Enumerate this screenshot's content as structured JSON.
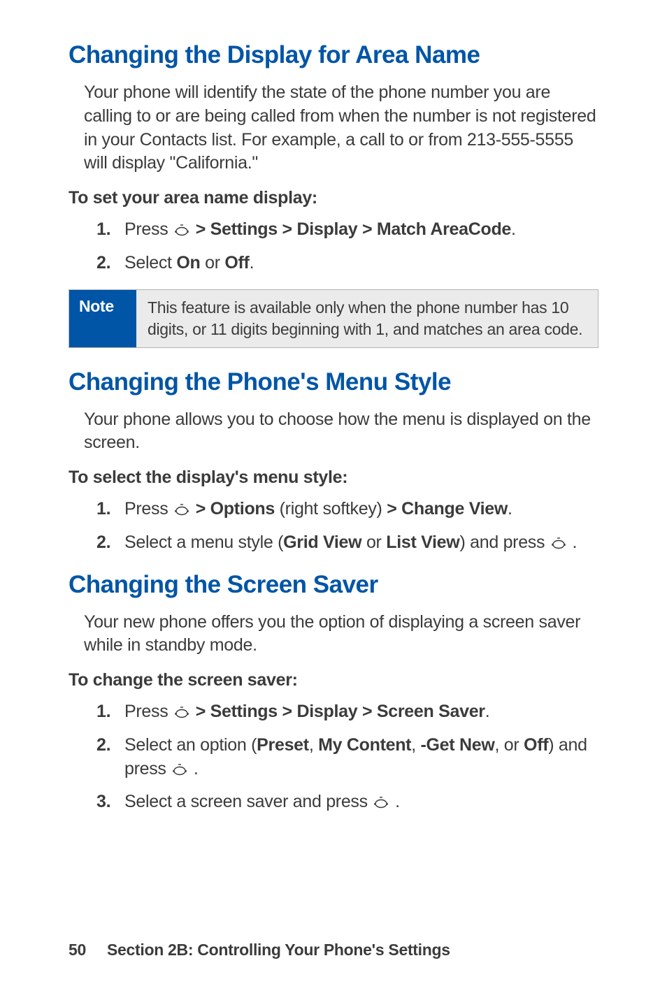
{
  "s1": {
    "heading": "Changing the Display for Area Name",
    "intro": "Your phone will identify the state of the phone number you are calling to or are being called from when the number is not registered in your Contacts list. For example, a call to or from 213-555-5555 will display \"California.\"",
    "subhead": "To set your area name display:",
    "step1": {
      "num": "1.",
      "t1": "Press ",
      "t2": " > Settings > Display > Match AreaCode",
      "t3": "."
    },
    "step2": {
      "num": "2.",
      "t1": "Select ",
      "b1": "On",
      "t2": " or ",
      "b2": "Off",
      "t3": "."
    },
    "note": {
      "label": "Note",
      "text": "This feature is available only when the phone number has 10 digits, or 11 digits beginning with 1, and matches an area code."
    }
  },
  "s2": {
    "heading": "Changing the Phone's Menu Style",
    "intro": "Your phone allows you to choose how the menu is displayed on the screen.",
    "subhead": "To select the display's menu style:",
    "step1": {
      "num": "1.",
      "t1": "Press ",
      "b1": " > Options",
      "t2": " (right softkey) ",
      "b2": "> Change View",
      "t3": "."
    },
    "step2": {
      "num": "2.",
      "t1": "Select a menu style (",
      "b1": "Grid View",
      "t2": " or ",
      "b2": "List View",
      "t3": ") and press ",
      "t4": " ."
    }
  },
  "s3": {
    "heading": "Changing the Screen Saver",
    "intro": "Your new phone offers you the option of displaying a screen saver while in standby mode.",
    "subhead": "To change the screen saver:",
    "step1": {
      "num": "1.",
      "t1": "Press ",
      "b1": " > Settings > Display > Screen Saver",
      "t2": "."
    },
    "step2": {
      "num": "2.",
      "t1": "Select an option (",
      "b1": "Preset",
      "t2": ", ",
      "b2": "My Content",
      "t3": ", ",
      "b3": "-Get New",
      "t4": ", or ",
      "b4": "Off",
      "t5": ") and press ",
      "t6": " ."
    },
    "step3": {
      "num": "3.",
      "t1": "Select a screen saver and press ",
      "t2": " ."
    }
  },
  "footer": {
    "page": "50",
    "section": "Section 2B: Controlling Your Phone's Settings"
  }
}
